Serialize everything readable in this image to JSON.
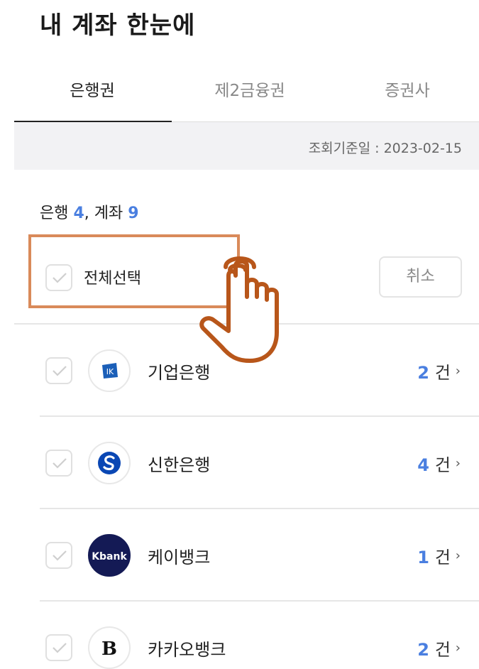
{
  "page": {
    "title": "내 계좌 한눈에"
  },
  "tabs": [
    {
      "label": "은행권",
      "active": true
    },
    {
      "label": "제2금융권",
      "active": false
    },
    {
      "label": "증권사",
      "active": false
    }
  ],
  "lookup_date": "조회기준일 : 2023-02-15",
  "summary": {
    "bank_label": "은행",
    "bank_count": "4",
    "account_label": ", 계좌",
    "account_count": "9"
  },
  "select_all": {
    "label": "전체선택",
    "cancel_label": "취소"
  },
  "banks": [
    {
      "name": "기업은행",
      "count": "2",
      "unit": "건",
      "logo": "ibk-logo"
    },
    {
      "name": "신한은행",
      "count": "4",
      "unit": "건",
      "logo": "shinhan-logo"
    },
    {
      "name": "케이뱅크",
      "count": "1",
      "unit": "건",
      "logo": "kbank-logo",
      "logo_text": "Kbank"
    },
    {
      "name": "카카오뱅크",
      "count": "2",
      "unit": "건",
      "logo": "kakaobank-logo",
      "logo_text": "B"
    }
  ],
  "colors": {
    "accent": "#4a7fe0",
    "highlight": "#d98a5a",
    "hand": "#b8561a"
  }
}
